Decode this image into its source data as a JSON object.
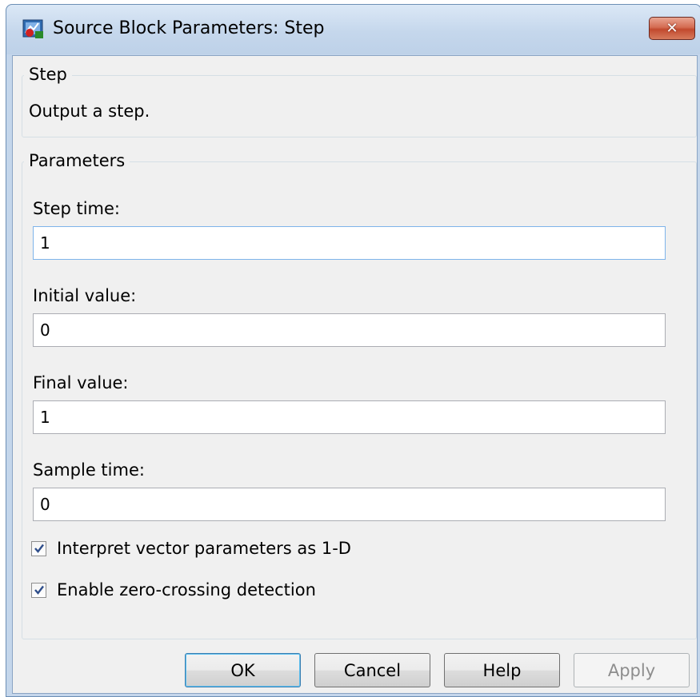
{
  "window": {
    "title": "Source Block Parameters: Step",
    "close_symbol": "✕"
  },
  "description_group": {
    "label": "Step",
    "text": "Output a step."
  },
  "parameters_group": {
    "label": "Parameters",
    "step_time": {
      "label": "Step time:",
      "value": "1"
    },
    "initial_value": {
      "label": "Initial value:",
      "value": "0"
    },
    "final_value": {
      "label": "Final value:",
      "value": "1"
    },
    "sample_time": {
      "label": "Sample time:",
      "value": "0"
    },
    "interpret_vector": {
      "label": "Interpret vector parameters as 1-D",
      "checked": true
    },
    "zero_crossing": {
      "label": "Enable zero-crossing detection",
      "checked": true
    }
  },
  "buttons": {
    "ok": "OK",
    "cancel": "Cancel",
    "help": "Help",
    "apply": "Apply"
  },
  "icons": {
    "app": "simulink-block-icon",
    "close": "close-icon",
    "check": "checkmark-icon"
  },
  "colors": {
    "titlebar": "#c5d7ec",
    "close_button": "#c24a2e",
    "dialog_bg": "#f0f0f0",
    "focus_border": "#7eb4ea"
  }
}
